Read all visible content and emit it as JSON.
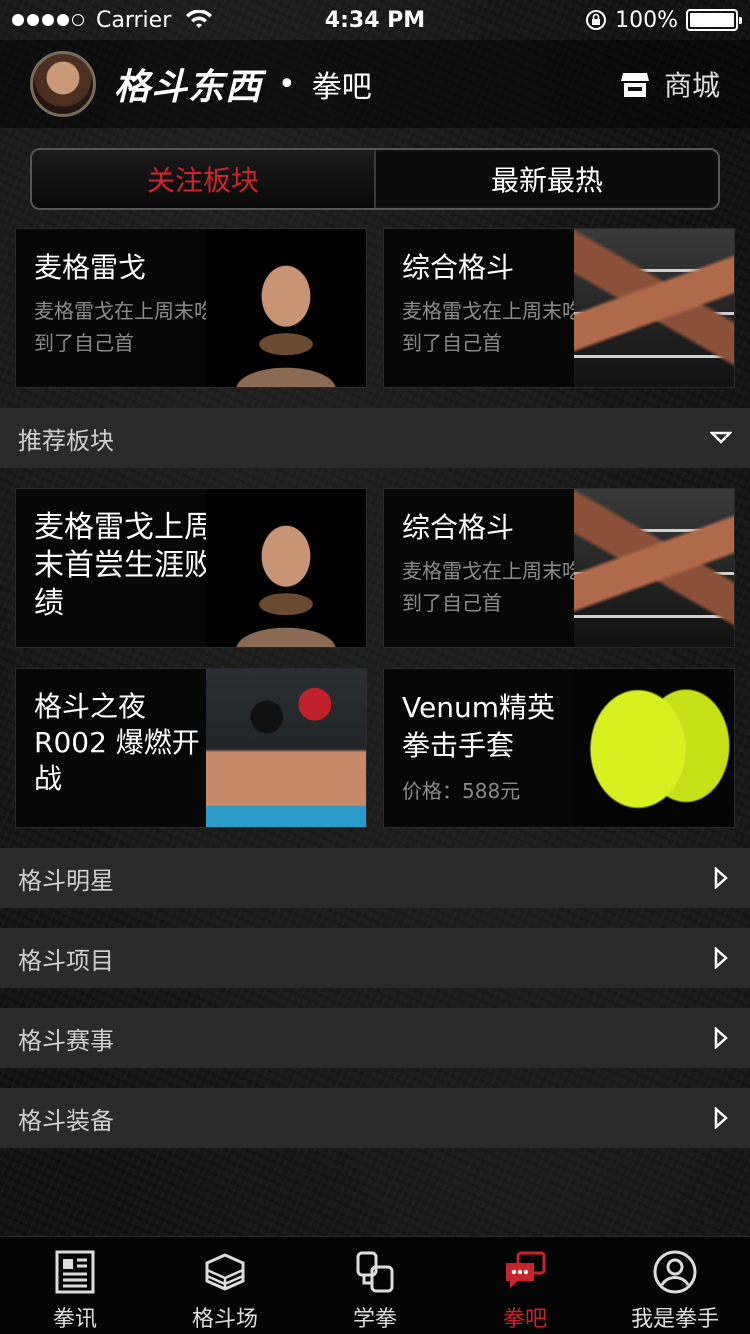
{
  "status_bar": {
    "carrier": "Carrier",
    "time": "4:34 PM",
    "battery": "100%"
  },
  "header": {
    "logo": "格斗东西",
    "section": "拳吧",
    "shop_label": "商城"
  },
  "segment": {
    "active": "关注板块",
    "inactive": "最新最热"
  },
  "followed_cards": [
    {
      "title": "麦格雷戈",
      "desc": "麦格雷戈在上周末吃到了自己首"
    },
    {
      "title": "综合格斗",
      "desc": "麦格雷戈在上周末吃到了自己首"
    }
  ],
  "recommended": {
    "label": "推荐板块",
    "cards": [
      {
        "title": "麦格雷戈上周末首尝生涯败绩",
        "desc": ""
      },
      {
        "title": "综合格斗",
        "desc": "麦格雷戈在上周末吃到了自己首"
      },
      {
        "title": "格斗之夜R002 爆燃开战",
        "desc": ""
      },
      {
        "title": "Venum精英拳击手套",
        "desc": "价格：588元"
      }
    ]
  },
  "sections": [
    {
      "label": "格斗明星"
    },
    {
      "label": "格斗项目"
    },
    {
      "label": "格斗赛事"
    },
    {
      "label": "格斗装备"
    }
  ],
  "tabbar": [
    {
      "label": "拳讯",
      "icon": "news-icon"
    },
    {
      "label": "格斗场",
      "icon": "ring-icon"
    },
    {
      "label": "学拳",
      "icon": "learn-icon"
    },
    {
      "label": "拳吧",
      "icon": "chat-icon"
    },
    {
      "label": "我是拳手",
      "icon": "profile-icon"
    }
  ],
  "colors": {
    "accent": "#c8232a",
    "bar": "#2a2a2a"
  }
}
